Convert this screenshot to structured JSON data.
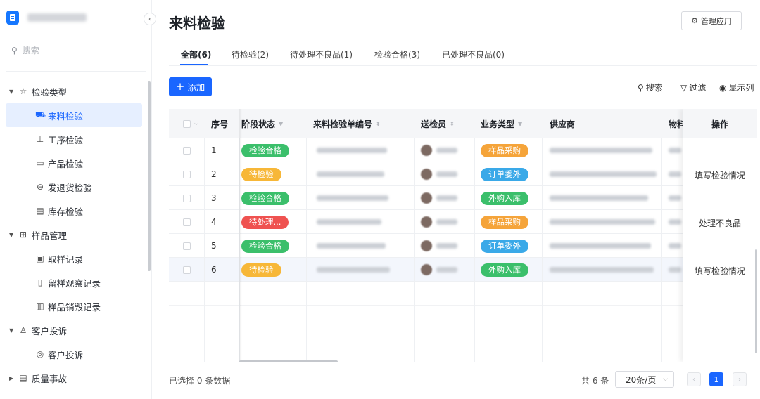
{
  "sidebar": {
    "search_placeholder": "搜索",
    "groups": [
      {
        "label": "检验类型",
        "icon": "star-icon"
      },
      {
        "label": "样品管理",
        "icon": "grid-icon"
      },
      {
        "label": "客户投诉",
        "icon": "person-icon"
      },
      {
        "label": "质量事故",
        "icon": "doc-icon"
      }
    ],
    "items": [
      {
        "label": "来料检验",
        "icon": "cart-icon"
      },
      {
        "label": "工序检验",
        "icon": "flow-icon"
      },
      {
        "label": "产品检验",
        "icon": "box-icon"
      },
      {
        "label": "发退货检验",
        "icon": "truck-icon"
      },
      {
        "label": "库存检验",
        "icon": "stack-icon"
      },
      {
        "label": "取样记录",
        "icon": "record-icon"
      },
      {
        "label": "留样观察记录",
        "icon": "file-icon"
      },
      {
        "label": "样品销毁记录",
        "icon": "chart-icon"
      },
      {
        "label": "客户投诉",
        "icon": "chat-icon"
      }
    ],
    "active_color": "#1a66ff"
  },
  "header": {
    "title": "来料检验",
    "manage_label": "管理应用"
  },
  "tabs": [
    {
      "label": "全部(6)"
    },
    {
      "label": "待检验(2)"
    },
    {
      "label": "待处理不良品(1)"
    },
    {
      "label": "检验合格(3)"
    },
    {
      "label": "已处理不良品(0)"
    }
  ],
  "toolbar": {
    "add_label": "添加",
    "search_label": "搜索",
    "filter_label": "过滤",
    "columns_label": "显示列"
  },
  "table": {
    "columns": [
      "序号",
      "阶段状态",
      "来料检验单编号",
      "送检员",
      "业务类型",
      "供应商",
      "物料",
      "操作"
    ],
    "rows": [
      {
        "no": "1",
        "status": "检验合格",
        "status_color": "#3bbf6b",
        "biz": "样品采购",
        "biz_color": "#f5a43a",
        "op": ""
      },
      {
        "no": "2",
        "status": "待检验",
        "status_color": "#f7b738",
        "biz": "订单委外",
        "biz_color": "#3aa9e8",
        "op": "填写检验情况"
      },
      {
        "no": "3",
        "status": "检验合格",
        "status_color": "#3bbf6b",
        "biz": "外购入库",
        "biz_color": "#3bbf6b",
        "op": ""
      },
      {
        "no": "4",
        "status": "待处理...",
        "status_color": "#ef5250",
        "biz": "样品采购",
        "biz_color": "#f5a43a",
        "op": "处理不良品"
      },
      {
        "no": "5",
        "status": "检验合格",
        "status_color": "#3bbf6b",
        "biz": "订单委外",
        "biz_color": "#3aa9e8",
        "op": ""
      },
      {
        "no": "6",
        "status": "待检验",
        "status_color": "#f7b738",
        "biz": "外购入库",
        "biz_color": "#3bbf6b",
        "op": "填写检验情况"
      }
    ]
  },
  "footer": {
    "selected": "已选择 0 条数据",
    "total": "共 6 条",
    "page_size": "20条/页",
    "current_page": "1"
  }
}
